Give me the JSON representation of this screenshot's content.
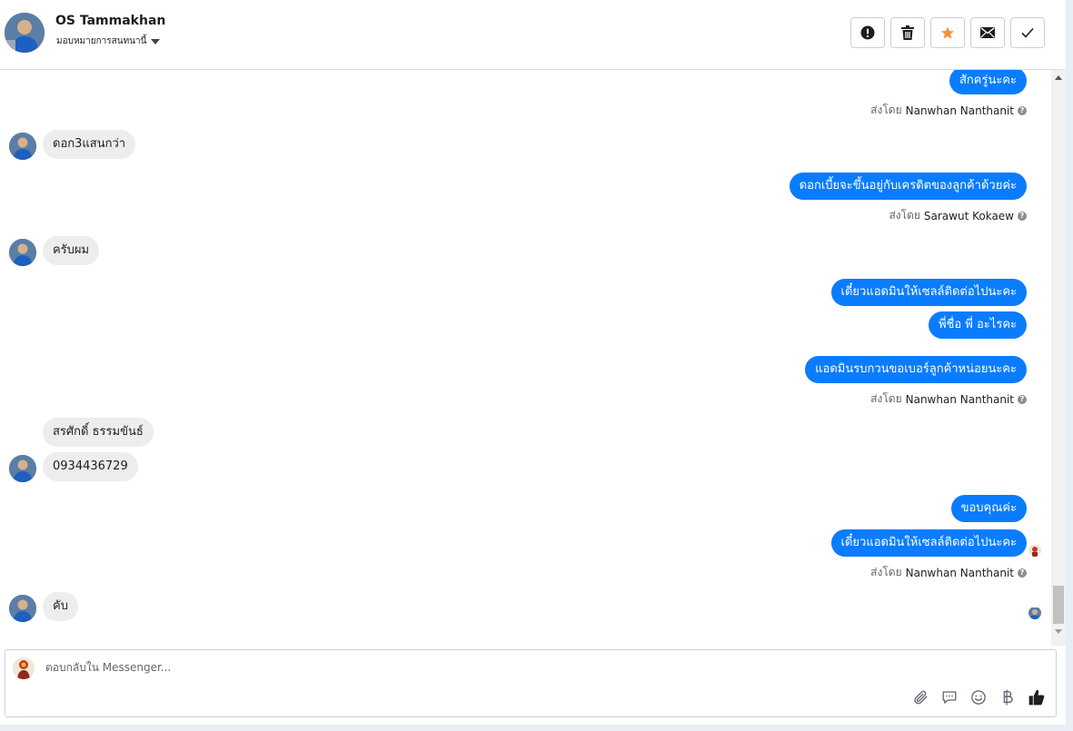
{
  "header": {
    "name": "OS Tammakhan",
    "assign_label": "มอบหมายการสนทนานี้"
  },
  "colors": {
    "accent": "#0a7cff",
    "incoming_bubble": "#ededed",
    "star": "#f7923b"
  },
  "actions": [
    {
      "name": "report",
      "icon": "alert-circle-icon"
    },
    {
      "name": "delete",
      "icon": "trash-icon"
    },
    {
      "name": "star",
      "icon": "star-icon"
    },
    {
      "name": "mark-unread",
      "icon": "envelope-icon"
    },
    {
      "name": "done",
      "icon": "check-icon"
    }
  ],
  "sentby_prefix": "ส่งโดย",
  "messages": {
    "m1": "สักครู่นะคะ",
    "s1": "Nanwhan Nanthanit",
    "m2": "ดอก3แสนกว่า",
    "m3": "ดอกเบี้ยจะขึ้นอยู่กับเครดิตของลูกค้าด้วยค่ะ",
    "s2": "Sarawut Kokaew",
    "m4": "ครับผม",
    "m5": "เดี๋ยวแอดมินให้เซลล์ติดต่อไปนะคะ",
    "m6": "พี่ชื่อ พี่ อะไรคะ",
    "m7": "แอดมินรบกวนขอเบอร์ลูกค้าหน่อยนะคะ",
    "s3": "Nanwhan Nanthanit",
    "m8": "สรศักดิ์ ธรรมขันธ์",
    "m9": "0934436729",
    "m10": "ขอบคุณค่ะ",
    "m11": "เดี๋ยวแอดมินให้เซลล์ติดต่อไปนะคะ",
    "s4": "Nanwhan Nanthanit",
    "m12": "คับ"
  },
  "composer": {
    "placeholder": "ตอบกลับใน Messenger...",
    "tools": [
      "paperclip-icon",
      "chat-bubble-icon",
      "smiley-icon",
      "baht-icon",
      "thumbs-up-icon"
    ]
  }
}
